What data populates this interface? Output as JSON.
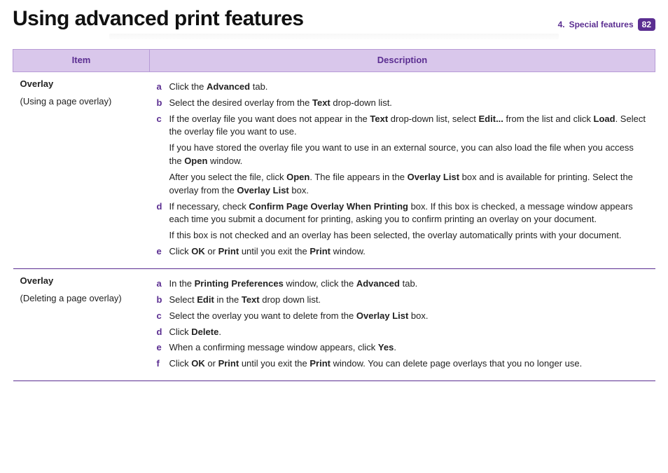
{
  "header": {
    "title": "Using advanced print features",
    "chapter_num": "4.",
    "chapter_label": "Special features",
    "page_number": "82"
  },
  "table": {
    "columns": [
      "Item",
      "Description"
    ],
    "rows": [
      {
        "item_title": "Overlay",
        "item_sub": "(Using a page overlay)",
        "steps": [
          {
            "letter": "a",
            "parts": [
              {
                "t": "Click the "
              },
              {
                "b": "Advanced"
              },
              {
                "t": " tab."
              }
            ]
          },
          {
            "letter": "b",
            "parts": [
              {
                "t": "Select the desired overlay from the "
              },
              {
                "b": "Text"
              },
              {
                "t": " drop-down list."
              }
            ]
          },
          {
            "letter": "c",
            "parts": [
              {
                "t": "If the overlay file you want does not appear in the "
              },
              {
                "b": "Text"
              },
              {
                "t": " drop-down list, select "
              },
              {
                "b": "Edit..."
              },
              {
                "t": " from the list and click "
              },
              {
                "b": "Load"
              },
              {
                "t": ". Select the overlay file you want to use."
              }
            ],
            "extras": [
              [
                {
                  "t": "If you have stored the overlay file you want to use in an external source, you can also load the file when you access the "
                },
                {
                  "b": "Open"
                },
                {
                  "t": " window."
                }
              ],
              [
                {
                  "t": "After you select the file, click "
                },
                {
                  "b": "Open"
                },
                {
                  "t": ". The file appears in the "
                },
                {
                  "b": "Overlay List"
                },
                {
                  "t": " box and is available for printing. Select the overlay from the "
                },
                {
                  "b": "Overlay List"
                },
                {
                  "t": " box."
                }
              ]
            ]
          },
          {
            "letter": "d",
            "parts": [
              {
                "t": "If necessary, check "
              },
              {
                "b": "Confirm Page Overlay When Printing"
              },
              {
                "t": " box. If this box is checked, a message window appears each time you submit a document for printing, asking you to confirm printing an overlay on your document."
              }
            ],
            "extras": [
              [
                {
                  "t": "If this box is not checked and an overlay has been selected, the overlay automatically prints with your document."
                }
              ]
            ]
          },
          {
            "letter": "e",
            "parts": [
              {
                "t": "Click "
              },
              {
                "b": "OK"
              },
              {
                "t": " or "
              },
              {
                "b": "Print"
              },
              {
                "t": " until you exit the "
              },
              {
                "b": "Print"
              },
              {
                "t": " window."
              }
            ]
          }
        ]
      },
      {
        "item_title": "Overlay",
        "item_sub": "(Deleting a page overlay)",
        "steps": [
          {
            "letter": "a",
            "parts": [
              {
                "t": "In the "
              },
              {
                "b": "Printing Preferences"
              },
              {
                "t": " window, click the "
              },
              {
                "b": "Advanced"
              },
              {
                "t": " tab."
              }
            ]
          },
          {
            "letter": "b",
            "parts": [
              {
                "t": "Select "
              },
              {
                "b": "Edit"
              },
              {
                "t": " in the "
              },
              {
                "b": "Text"
              },
              {
                "t": " drop down list."
              }
            ]
          },
          {
            "letter": "c",
            "parts": [
              {
                "t": "Select the overlay you want to delete from the "
              },
              {
                "b": "Overlay List"
              },
              {
                "t": " box."
              }
            ]
          },
          {
            "letter": "d",
            "parts": [
              {
                "t": "Click "
              },
              {
                "b": "Delete"
              },
              {
                "t": "."
              }
            ]
          },
          {
            "letter": "e",
            "parts": [
              {
                "t": "When a confirming message window appears, click "
              },
              {
                "b": "Yes"
              },
              {
                "t": "."
              }
            ]
          },
          {
            "letter": "f",
            "parts": [
              {
                "t": "Click "
              },
              {
                "b": "OK"
              },
              {
                "t": " or "
              },
              {
                "b": "Print"
              },
              {
                "t": " until you exit the "
              },
              {
                "b": "Print"
              },
              {
                "t": " window. You can delete page overlays that you no longer use."
              }
            ]
          }
        ]
      }
    ]
  }
}
